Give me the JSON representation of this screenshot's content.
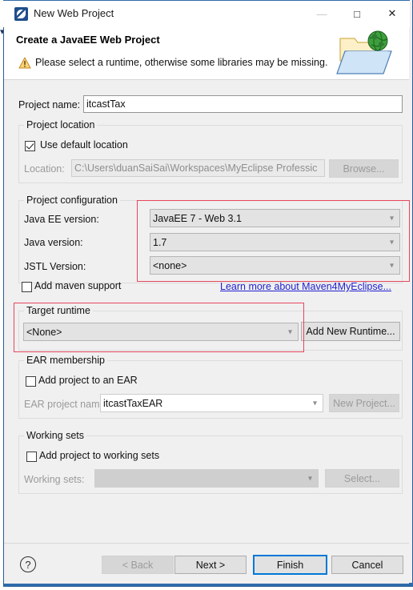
{
  "window": {
    "title": "New Web Project",
    "app_icon": "myeclipse-icon",
    "minimize_label": "—",
    "maximize_label": "□",
    "close_label": "✕"
  },
  "header": {
    "title": "Create a JavaEE Web Project",
    "message": "Please select a runtime, otherwise some libraries may be missing.",
    "warning_icon": "warning-triangle-icon",
    "banner_icon": "web-project-folder-globe-icon"
  },
  "form": {
    "project_name": {
      "label": "Project name:",
      "value": "itcastTax"
    },
    "project_location": {
      "group_label": "Project location",
      "use_default_label": "Use default location",
      "use_default_checked": true,
      "location_label": "Location:",
      "location_value": "C:\\Users\\duanSaiSai\\Workspaces\\MyEclipse Professic",
      "browse_label": "Browse..."
    },
    "project_configuration": {
      "group_label": "Project configuration",
      "javaee_version_label": "Java EE version:",
      "javaee_version_value": "JavaEE 7 - Web 3.1",
      "java_version_label": "Java version:",
      "java_version_value": "1.7",
      "jstl_version_label": "JSTL Version:",
      "jstl_version_value": "<none>",
      "add_maven_label": "Add maven support",
      "add_maven_checked": false,
      "maven_link": "Learn more about Maven4MyEclipse..."
    },
    "target_runtime": {
      "group_label": "Target runtime",
      "value": "<None>",
      "add_runtime_label": "Add New Runtime..."
    },
    "ear_membership": {
      "group_label": "EAR membership",
      "add_to_ear_label": "Add project to an EAR",
      "add_to_ear_checked": false,
      "ear_name_label": "EAR project name:",
      "ear_name_value": "itcastTaxEAR",
      "new_project_label": "New Project..."
    },
    "working_sets": {
      "group_label": "Working sets",
      "add_to_working_sets_label": "Add project to working sets",
      "add_to_working_sets_checked": false,
      "working_sets_label": "Working sets:",
      "working_sets_value": "",
      "select_label": "Select..."
    }
  },
  "footer": {
    "help_label": "?",
    "back_label": "< Back",
    "next_label": "Next >",
    "finish_label": "Finish",
    "cancel_label": "Cancel"
  },
  "annotations": {
    "highlight_color": "#e8465c",
    "boxes": [
      {
        "name": "project-configuration-highlight"
      },
      {
        "name": "target-runtime-highlight"
      }
    ]
  },
  "colors": {
    "window_border": "#2f6bab",
    "accent_button": "#0078d7",
    "link": "#2121d0",
    "dialog_bg": "#f0f0f0"
  }
}
